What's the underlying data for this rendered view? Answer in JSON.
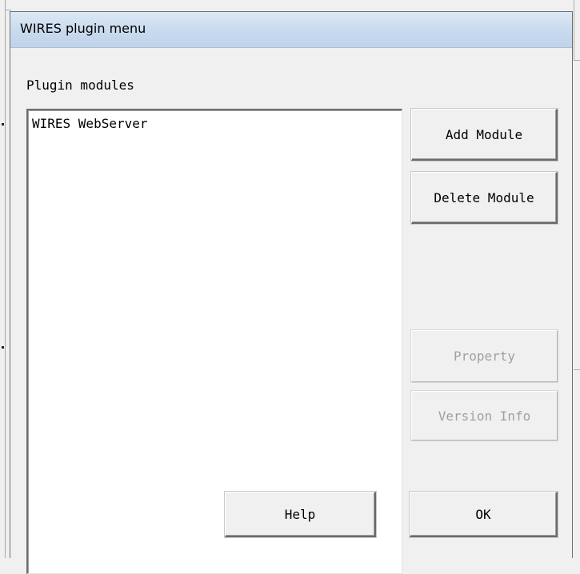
{
  "window": {
    "title": "WIRES plugin menu"
  },
  "modules_label": "Plugin modules",
  "modules_list": {
    "items": [
      "WIRES WebServer"
    ]
  },
  "buttons": {
    "add_module": "Add Module",
    "delete_module": "Delete Module",
    "property": "Property",
    "version_info": "Version Info",
    "help": "Help",
    "ok": "OK"
  }
}
